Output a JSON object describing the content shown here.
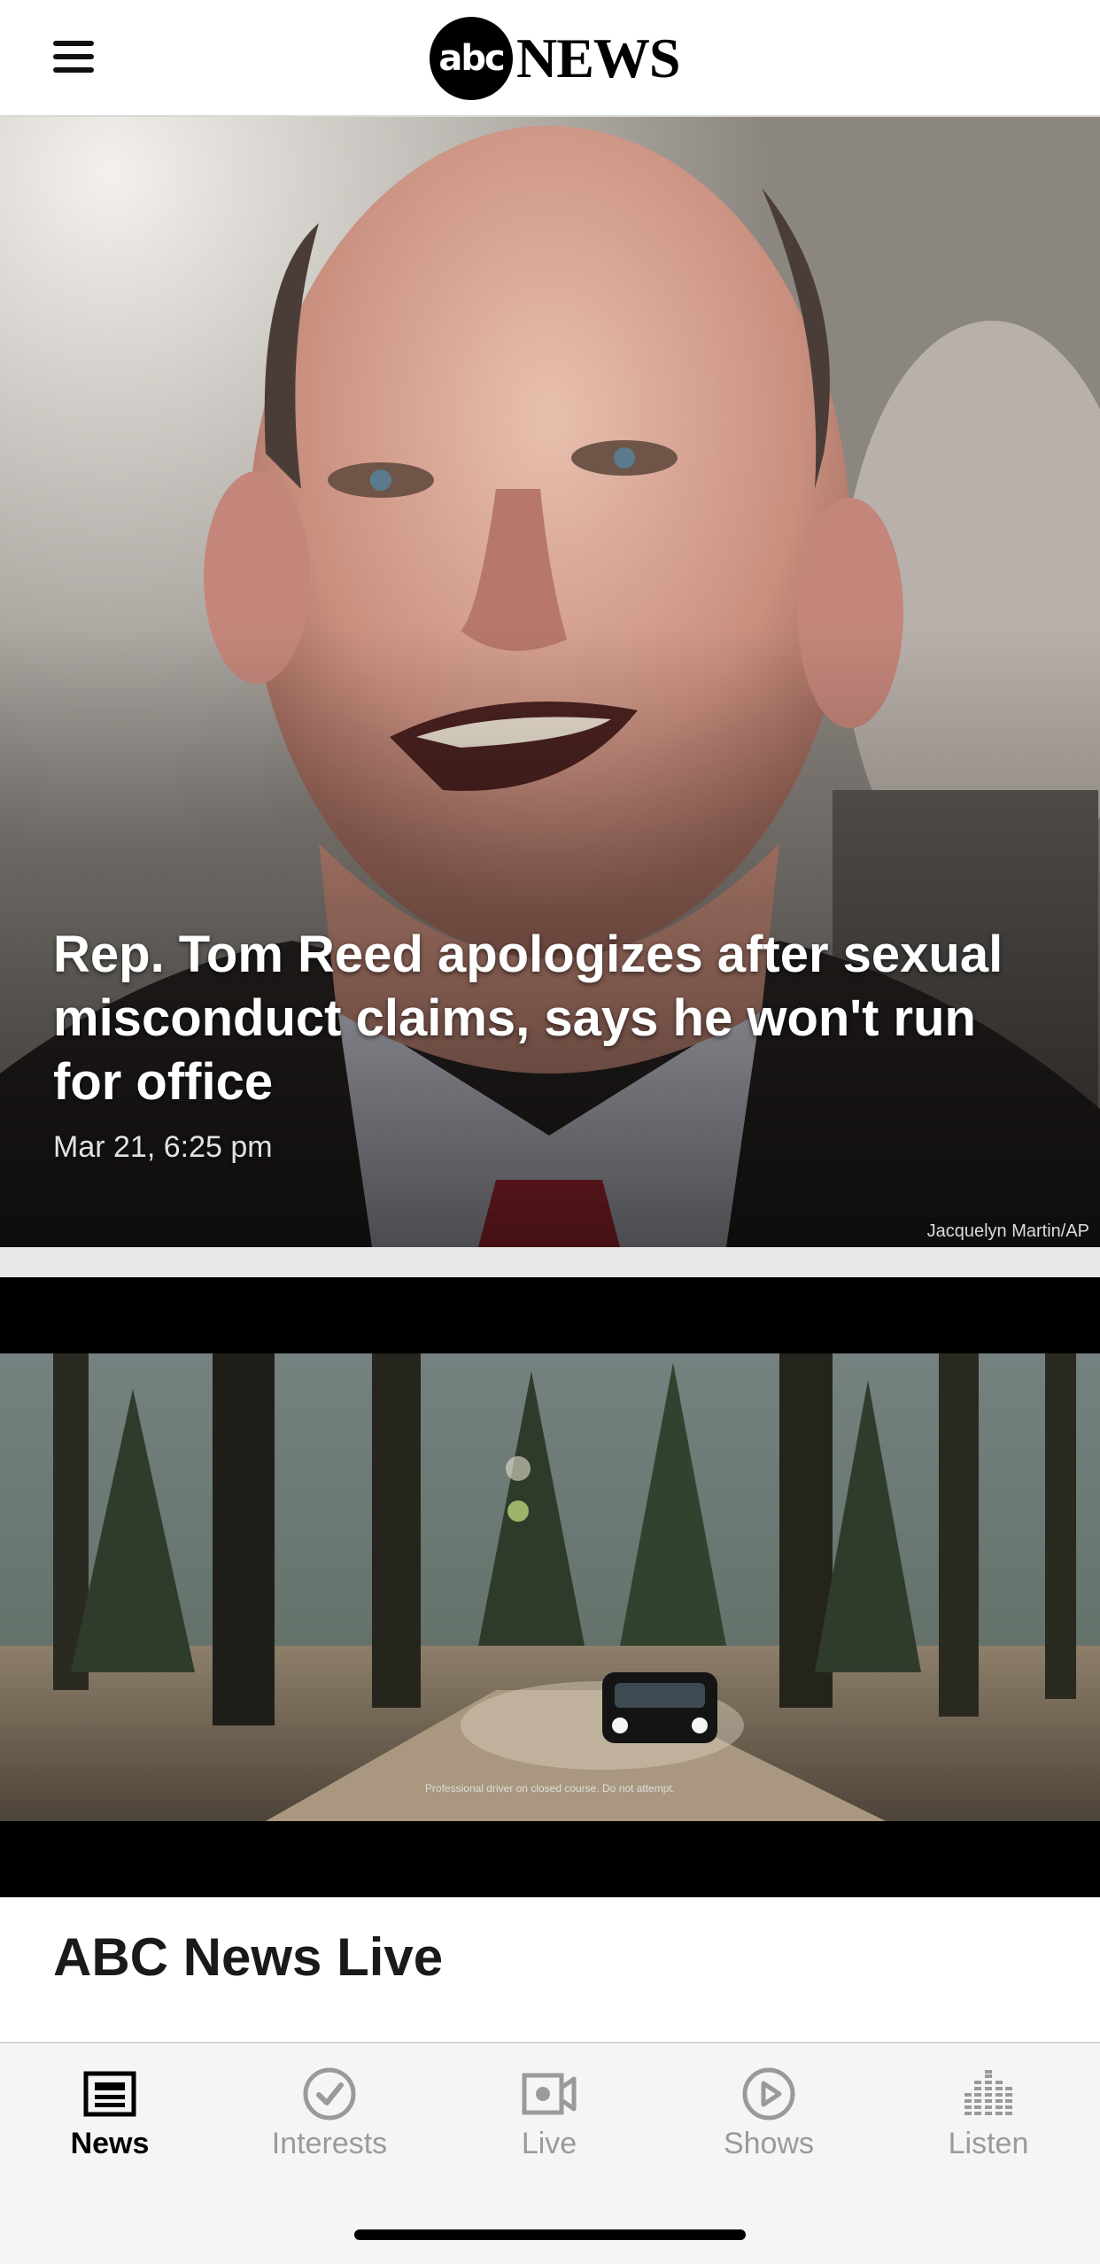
{
  "header": {
    "logo_mark": "abc",
    "logo_word": "NEWS"
  },
  "hero": {
    "headline": "Rep. Tom Reed apologizes after sexual misconduct claims, says he won't run for office",
    "timestamp": "Mar 21, 6:25 pm",
    "photo_credit": "Jacquelyn Martin/AP"
  },
  "video": {
    "caption": "Professional driver on closed course. Do not attempt."
  },
  "section": {
    "title": "ABC News Live"
  },
  "tabbar": {
    "active_color": "#000000",
    "inactive_color": "#9a9a9a",
    "tabs": [
      {
        "label": "News",
        "icon": "newspaper-icon",
        "active": true
      },
      {
        "label": "Interests",
        "icon": "check-circle-icon",
        "active": false
      },
      {
        "label": "Live",
        "icon": "video-camera-icon",
        "active": false
      },
      {
        "label": "Shows",
        "icon": "play-circle-icon",
        "active": false
      },
      {
        "label": "Listen",
        "icon": "audio-bars-icon",
        "active": false
      }
    ]
  }
}
